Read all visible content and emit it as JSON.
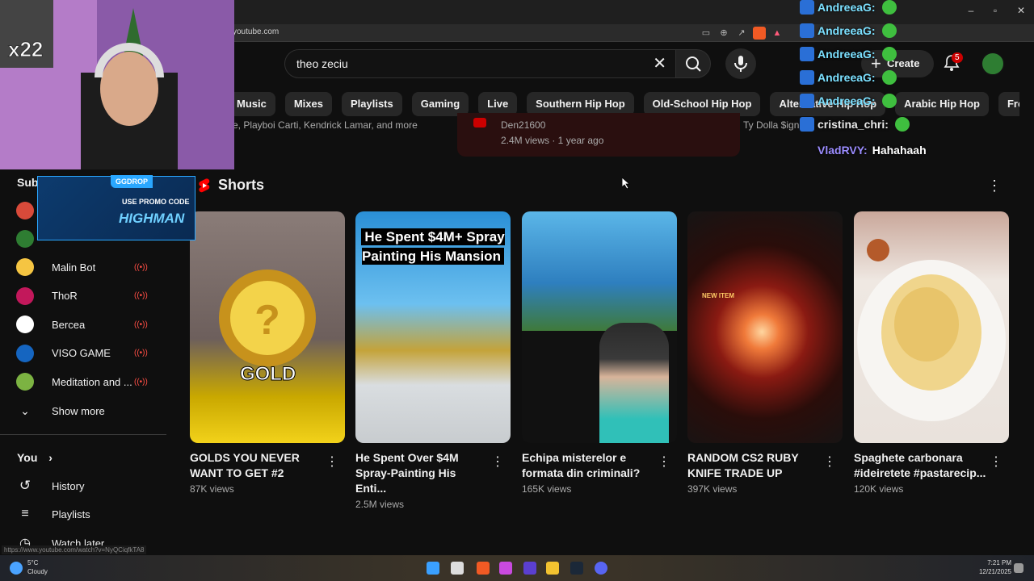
{
  "browser": {
    "url": "youtube.com",
    "status_url": "https://www.youtube.com/watch?v=NyQCiqfkTA8"
  },
  "header": {
    "search_value": "theo zeciu",
    "create_label": "Create",
    "notification_count": "5"
  },
  "chips": [
    "Music",
    "Mixes",
    "Playlists",
    "Gaming",
    "Live",
    "Southern Hip Hop",
    "Old-School Hip Hop",
    "Alternative Hip Hop",
    "Arabic Hip Hop",
    "Freestyle Rap"
  ],
  "partial_row": {
    "left_text": "e, Playboi Carti, Kendrick Lamar, and more",
    "channel": "Den21600",
    "meta": "2.4M views · 1 year ago",
    "right_text": "Ty Dolla $ign"
  },
  "shorts": {
    "heading": "Shorts",
    "items": [
      {
        "title": "GOLDS YOU NEVER WANT TO GET #2",
        "views": "87K views",
        "overlay": "GOLD"
      },
      {
        "title": "He Spent Over $4M Spray-Painting His Enti...",
        "views": "2.5M views",
        "overlay": "He Spent $4M+ Spray Painting His Mansion"
      },
      {
        "title": "Echipa misterelor e formata din criminali?",
        "views": "165K views",
        "overlay": ""
      },
      {
        "title": "RANDOM CS2 RUBY KNIFE TRADE UP",
        "views": "397K views",
        "overlay": "NEW ITEM"
      },
      {
        "title": "Spaghete carbonara #ideiretete #pastarecip...",
        "views": "120K views",
        "overlay": ""
      }
    ]
  },
  "sidebar": {
    "subscriptions_label": "Subscriptions",
    "channels": [
      {
        "name": "Malin Bot",
        "color": "#f5c542"
      },
      {
        "name": "ThoR",
        "color": "#c2185b"
      },
      {
        "name": "Bercea",
        "color": "#ffffff"
      },
      {
        "name": "VISO GAME",
        "color": "#1565c0"
      },
      {
        "name": "Meditation and ...",
        "color": "#7cb342"
      }
    ],
    "show_more": "Show more",
    "you_label": "You",
    "you_items": [
      "History",
      "Playlists",
      "Watch later"
    ]
  },
  "overlay": {
    "multiplier": "x22",
    "promo_tag": "GGDROP",
    "promo_line1": "USE PROMO CODE",
    "promo_line2": "HIGHMAN"
  },
  "chat": [
    {
      "user": "AndreeaG:",
      "msg": "",
      "color": "#7be0ff"
    },
    {
      "user": "AndreeaG:",
      "msg": "",
      "color": "#7be0ff"
    },
    {
      "user": "AndreeaG:",
      "msg": "",
      "color": "#7be0ff"
    },
    {
      "user": "AndreeaG:",
      "msg": "",
      "color": "#7be0ff"
    },
    {
      "user": "AndreeaG:",
      "msg": "",
      "color": "#7be0ff"
    },
    {
      "user": "cristina_chri:",
      "msg": "",
      "color": "#e8e8e8"
    },
    {
      "user": "VladRVY:",
      "msg": "Hahahaah",
      "color": "#9b8cff"
    }
  ],
  "taskbar": {
    "temperature": "5°C",
    "weather": "Cloudy",
    "time": "7:21 PM",
    "date": "12/21/2025"
  },
  "colors": {
    "accent_red": "#ff0000",
    "live_red": "#ff4e45",
    "bg": "#0f0f0f"
  }
}
